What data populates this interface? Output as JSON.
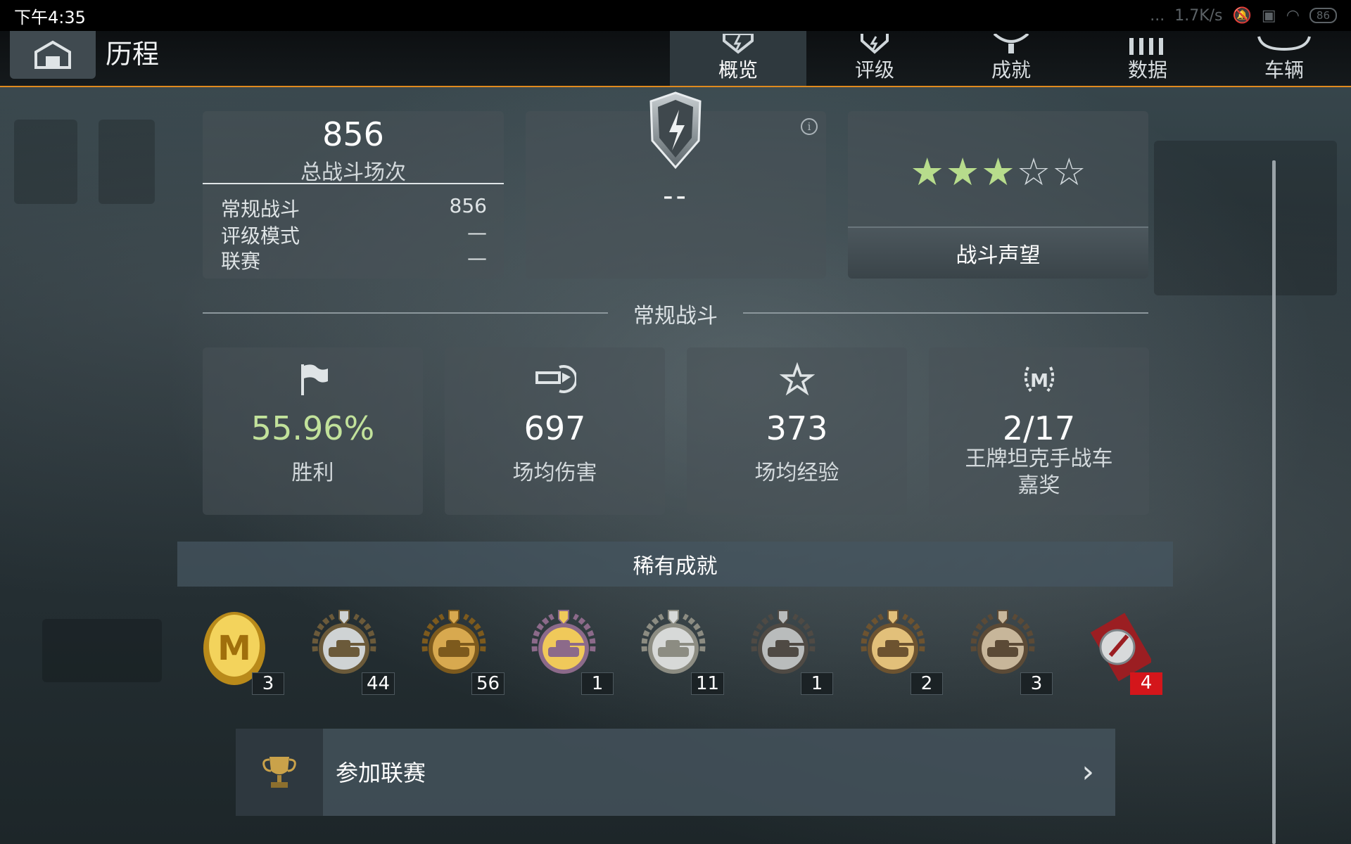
{
  "status_bar": {
    "time": "下午4:35",
    "dots": "...",
    "net_speed": "1.7K/s",
    "battery": "86"
  },
  "header": {
    "title": "历程",
    "tabs": [
      {
        "label": "概览",
        "icon": "shield-tab-icon",
        "active": true
      },
      {
        "label": "评级",
        "icon": "rating-icon",
        "active": false
      },
      {
        "label": "成就",
        "icon": "trophy-icon",
        "active": false
      },
      {
        "label": "数据",
        "icon": "bars-icon",
        "active": false
      },
      {
        "label": "车辆",
        "icon": "vehicle-icon",
        "active": false
      }
    ]
  },
  "battles_card": {
    "total": "856",
    "total_label": "总战斗场次",
    "rows": [
      {
        "label": "常规战斗",
        "value": "856"
      },
      {
        "label": "评级模式",
        "value": "—"
      },
      {
        "label": "联赛",
        "value": "—"
      }
    ]
  },
  "rank_card": {
    "value": "--",
    "info": "i"
  },
  "reputation_card": {
    "stars_filled": 3,
    "stars_total": 5,
    "button_label": "战斗声望",
    "star_filled_color": "#b7dc8c"
  },
  "regular_section": {
    "title": "常规战斗"
  },
  "stats": [
    {
      "value": "55.96%",
      "label": "胜利",
      "icon": "flag-icon",
      "highlight": true
    },
    {
      "value": "697",
      "label": "场均伤害",
      "icon": "shell-icon",
      "highlight": false
    },
    {
      "value": "373",
      "label": "场均经验",
      "icon": "star-icon",
      "highlight": false
    },
    {
      "value": "2/17",
      "label": "王牌坦克手战车嘉奖",
      "label_line1": "王牌坦克手战车",
      "label_line2": "嘉奖",
      "icon": "mastery-icon",
      "highlight": false
    }
  ],
  "rare_achievements": {
    "title": "稀有成就",
    "medals": [
      {
        "icon": "mastery-gold-medal-icon",
        "count": "3"
      },
      {
        "icon": "sword-shield-medal-icon",
        "count": "44"
      },
      {
        "icon": "bronze-tank-medal-icon",
        "count": "56"
      },
      {
        "icon": "gold-tank-medal-icon",
        "count": "1"
      },
      {
        "icon": "silver-tank-medal-icon",
        "count": "11"
      },
      {
        "icon": "dark-tank-medal-icon",
        "count": "1"
      },
      {
        "icon": "round-tank-medal-icon",
        "count": "2"
      },
      {
        "icon": "laurel-tank-medal-icon",
        "count": "3"
      },
      {
        "icon": "ribbon-badge-icon",
        "count": "4"
      }
    ]
  },
  "league": {
    "label": "参加联赛",
    "icon": "cup-icon"
  }
}
